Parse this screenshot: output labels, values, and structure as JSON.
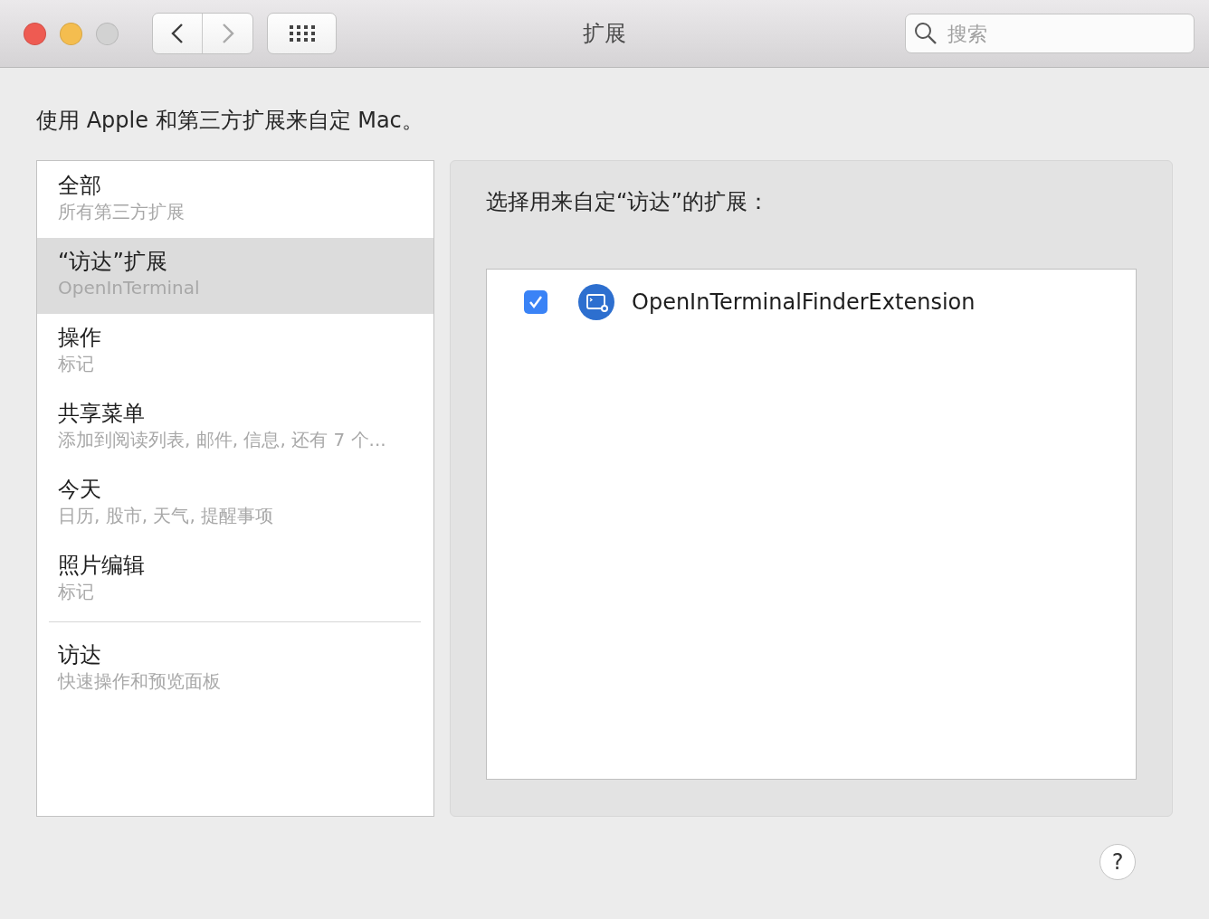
{
  "window": {
    "title": "扩展",
    "traffic_lights": [
      {
        "color": "#ee5b52"
      },
      {
        "color": "#f4bd4f"
      },
      {
        "color": "#d2d2d2"
      }
    ]
  },
  "nav": [
    {
      "kind": "back",
      "disabled": false
    },
    {
      "kind": "forward",
      "disabled": true
    }
  ],
  "search": {
    "placeholder": "搜索"
  },
  "description": "使用 Apple 和第三方扩展来自定 Mac。",
  "sidebar": {
    "groups": [
      [
        {
          "title": "全部",
          "subtitle": "所有第三方扩展",
          "selected": false
        },
        {
          "title": "“访达”扩展",
          "subtitle": "OpenInTerminal",
          "selected": true
        },
        {
          "title": "操作",
          "subtitle": "标记",
          "selected": false
        },
        {
          "title": "共享菜单",
          "subtitle": "添加到阅读列表, 邮件, 信息, 还有 7 个...",
          "selected": false
        },
        {
          "title": "今天",
          "subtitle": "日历, 股市, 天气, 提醒事项",
          "selected": false
        },
        {
          "title": "照片编辑",
          "subtitle": "标记",
          "selected": false
        }
      ],
      [
        {
          "title": "访达",
          "subtitle": "快速操作和预览面板",
          "selected": false
        }
      ]
    ]
  },
  "panel": {
    "heading": "选择用来自定“访达”的扩展：",
    "extensions": [
      {
        "name": "OpenInTerminalFinderExtension",
        "checked": true
      }
    ]
  },
  "help": "?"
}
